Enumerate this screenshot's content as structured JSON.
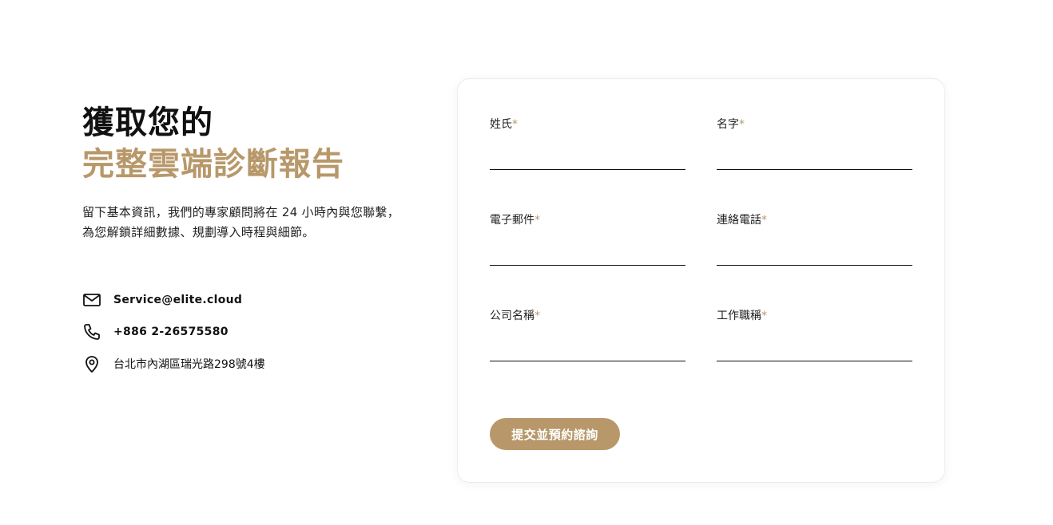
{
  "hero": {
    "title_line1": "獲取您的",
    "title_line2": "完整雲端診斷報告",
    "description": "留下基本資訊，我們的專家顧問將在 24 小時內與您聯繫，為您解鎖詳細數據、規劃導入時程與細節。"
  },
  "contact": {
    "email": "Service@elite.cloud",
    "phone": "+886 2-26575580",
    "address": "台北市內湖區瑞光路298號4樓",
    "icons": [
      "mail-icon",
      "phone-icon",
      "location-pin-icon"
    ]
  },
  "form": {
    "required_mark": "*",
    "fields": {
      "last_name": {
        "label": "姓氏",
        "value": ""
      },
      "first_name": {
        "label": "名字",
        "value": ""
      },
      "email": {
        "label": "電子郵件",
        "value": ""
      },
      "phone": {
        "label": "連絡電話",
        "value": ""
      },
      "company": {
        "label": "公司名稱",
        "value": ""
      },
      "job_title": {
        "label": "工作職稱",
        "value": ""
      }
    },
    "submit_label": "提交並預約諮詢"
  },
  "colors": {
    "accent": "#b8986a",
    "text": "#111111",
    "background": "#ffffff"
  }
}
